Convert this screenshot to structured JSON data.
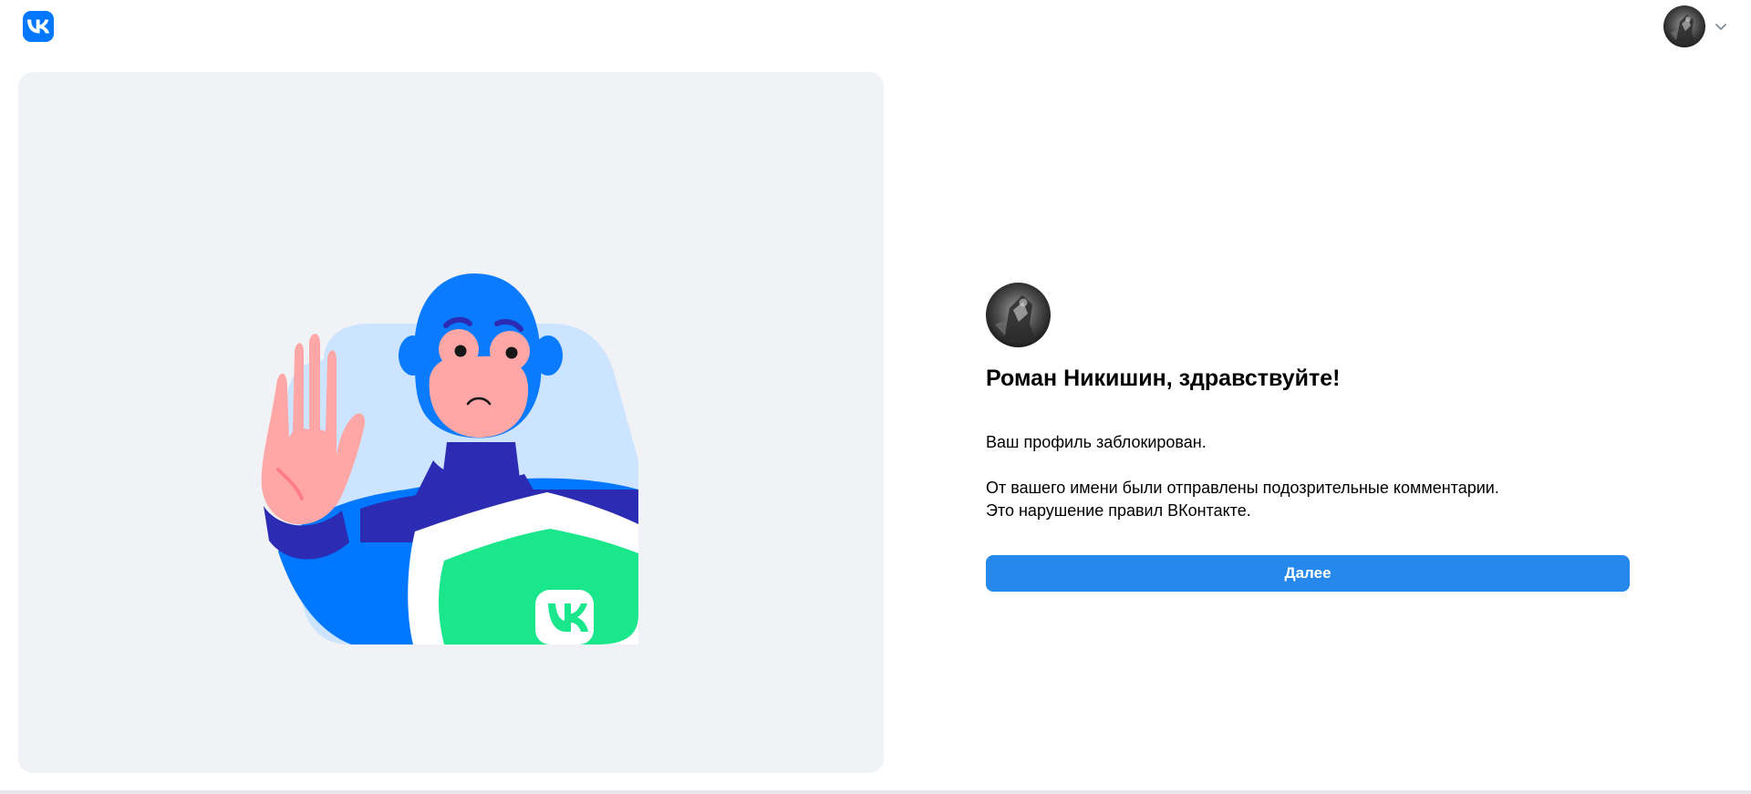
{
  "header": {
    "logo_icon": "vk-logo-icon",
    "avatar_icon": "user-avatar",
    "menu_icon": "chevron-down-icon"
  },
  "illustration": {
    "description_icon": "blocked-hero-with-vk-shield",
    "brand_color": "#0077ff",
    "shield_color": "#1ae68b"
  },
  "main": {
    "greeting": "Роман Никишин, здравствуйте!",
    "line1": "Ваш профиль заблокирован.",
    "line2": "От вашего имени были отправлены подозрительные комментарии.",
    "line3": "Это нарушение правил ВКонтакте.",
    "next_label": "Далее",
    "button_color": "#2688eb"
  }
}
